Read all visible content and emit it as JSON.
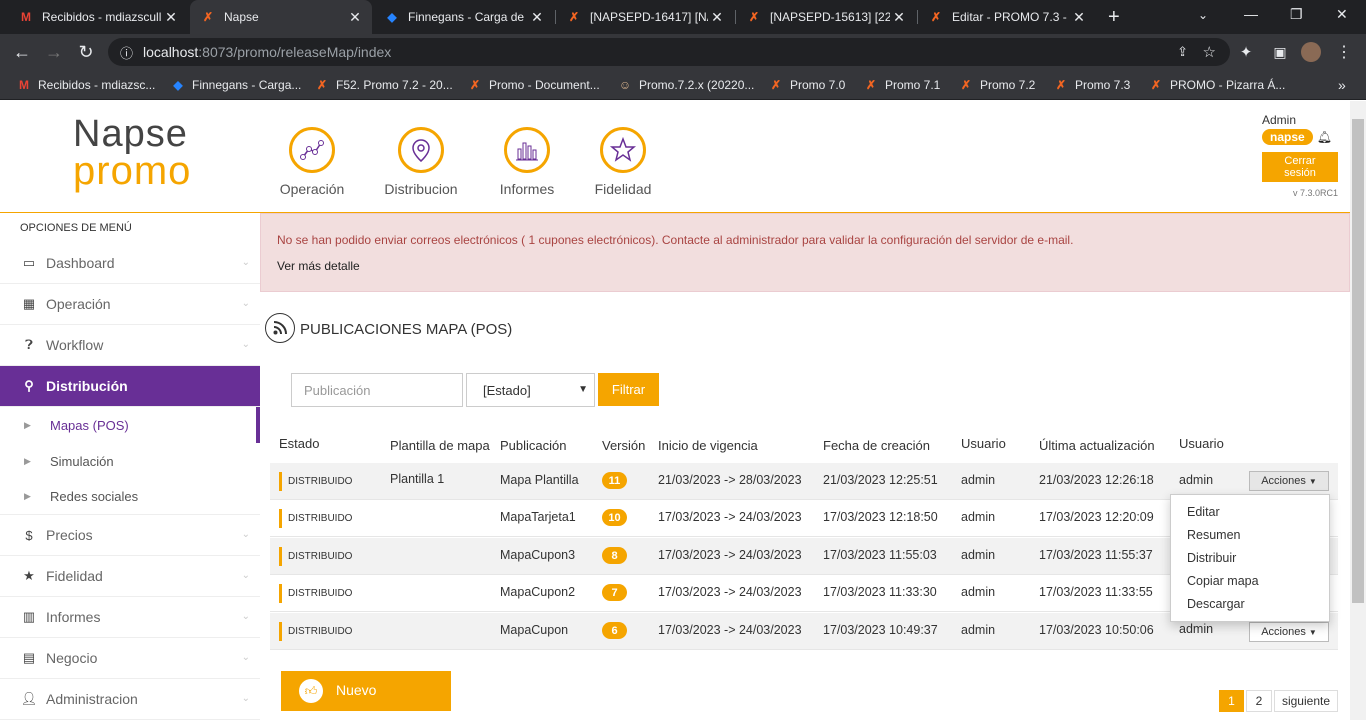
{
  "browser": {
    "tabs": [
      {
        "title": "Recibidos - mdiazscull",
        "icon": "gmail-icon"
      },
      {
        "title": "Napse",
        "icon": "napse-icon",
        "active": true
      },
      {
        "title": "Finnegans - Carga de",
        "icon": "jira-icon"
      },
      {
        "title": "[NAPSEPD-16417] [NA",
        "icon": "napse-icon"
      },
      {
        "title": "[NAPSEPD-15613] [22",
        "icon": "napse-icon"
      },
      {
        "title": "Editar - PROMO 7.3 - ",
        "icon": "napse-icon"
      }
    ],
    "url_host": "localhost",
    "url_path": ":8073/promo/releaseMap/index",
    "bookmarks": [
      {
        "label": "Recibidos - mdiazsc...",
        "icon": "gmail-icon"
      },
      {
        "label": "Finnegans - Carga...",
        "icon": "jira-icon"
      },
      {
        "label": "F52. Promo 7.2 - 20...",
        "icon": "napse-icon"
      },
      {
        "label": "Promo - Document...",
        "icon": "napse-icon"
      },
      {
        "label": "Promo.7.2.x (20220...",
        "icon": "jenkins-icon"
      },
      {
        "label": "Promo 7.0",
        "icon": "napse-icon"
      },
      {
        "label": "Promo 7.1",
        "icon": "napse-icon"
      },
      {
        "label": "Promo 7.2",
        "icon": "napse-icon"
      },
      {
        "label": "Promo 7.3",
        "icon": "napse-icon"
      },
      {
        "label": "PROMO - Pizarra Á...",
        "icon": "napse-icon"
      }
    ]
  },
  "header": {
    "logo_top": "Napse",
    "logo_bottom": "promo",
    "nav": [
      {
        "label": "Operación",
        "icon": "graph-icon"
      },
      {
        "label": "Distribucion",
        "icon": "map-pin-icon"
      },
      {
        "label": "Informes",
        "icon": "bar-chart-icon"
      },
      {
        "label": "Fidelidad",
        "icon": "star-icon"
      }
    ],
    "user": "Admin",
    "role": "napse",
    "logout": "Cerrar sesión",
    "version": "v 7.3.0RC1"
  },
  "sidebar": {
    "title": "OPCIONES DE MENÚ",
    "items": [
      {
        "label": "Dashboard",
        "icon": "laptop-icon"
      },
      {
        "label": "Operación",
        "icon": "grid-icon"
      },
      {
        "label": "Workflow",
        "icon": "question-circle-icon"
      },
      {
        "label": "Distribución",
        "icon": "map-pin-icon",
        "active": true
      },
      {
        "label": "Precios",
        "icon": "dollar-icon"
      },
      {
        "label": "Fidelidad",
        "icon": "star-icon"
      },
      {
        "label": "Informes",
        "icon": "bar-chart-icon"
      },
      {
        "label": "Negocio",
        "icon": "building-icon"
      },
      {
        "label": "Administracion",
        "icon": "user-icon"
      }
    ],
    "subitems": [
      {
        "label": "Mapas (POS)",
        "selected": true
      },
      {
        "label": "Simulación"
      },
      {
        "label": "Redes sociales"
      }
    ]
  },
  "alert": {
    "message": "No se han podido enviar correos electrónicos ( 1 cupones electrónicos). Contacte al administrador para validar la configuración del servidor de e-mail.",
    "link": "Ver más detalle"
  },
  "page": {
    "title": "PUBLICACIONES MAPA (POS)",
    "filters": {
      "publication_placeholder": "Publicación",
      "status_selected": "[Estado]",
      "filter_button": "Filtrar"
    }
  },
  "table": {
    "headers": [
      "Estado",
      "Plantilla de mapa",
      "Publicación",
      "Versión",
      "Inicio de vigencia",
      "Fecha de creación",
      "Usuario",
      "Última actualización",
      "Usuario"
    ],
    "rows": [
      {
        "status": "DISTRIBUIDO",
        "template": "Plantilla 1",
        "publication": "Mapa Plantilla",
        "version": "11",
        "validity": "21/03/2023 -> 28/03/2023",
        "created": "21/03/2023 12:25:51",
        "user": "admin",
        "updated": "21/03/2023 12:26:18",
        "updated_user": "admin"
      },
      {
        "status": "DISTRIBUIDO",
        "template": "",
        "publication": "MapaTarjeta1",
        "version": "10",
        "validity": "17/03/2023 -> 24/03/2023",
        "created": "17/03/2023 12:18:50",
        "user": "admin",
        "updated": "17/03/2023 12:20:09",
        "updated_user": ""
      },
      {
        "status": "DISTRIBUIDO",
        "template": "",
        "publication": "MapaCupon3",
        "version": "8",
        "validity": "17/03/2023 -> 24/03/2023",
        "created": "17/03/2023 11:55:03",
        "user": "admin",
        "updated": "17/03/2023 11:55:37",
        "updated_user": ""
      },
      {
        "status": "DISTRIBUIDO",
        "template": "",
        "publication": "MapaCupon2",
        "version": "7",
        "validity": "17/03/2023 -> 24/03/2023",
        "created": "17/03/2023 11:33:30",
        "user": "admin",
        "updated": "17/03/2023 11:33:55",
        "updated_user": ""
      },
      {
        "status": "DISTRIBUIDO",
        "template": "",
        "publication": "MapaCupon",
        "version": "6",
        "validity": "17/03/2023 -> 24/03/2023",
        "created": "17/03/2023 10:49:37",
        "user": "admin",
        "updated": "17/03/2023 10:50:06",
        "updated_user": "admin"
      }
    ],
    "actions_label": "Acciones",
    "actions_menu": [
      "Editar",
      "Resumen",
      "Distribuir",
      "Copiar mapa",
      "Descargar"
    ]
  },
  "footer": {
    "new_button": "Nuevo",
    "pages": [
      "1",
      "2"
    ],
    "next": "siguiente"
  },
  "colors": {
    "accent": "#f5a500",
    "purple": "#682f96",
    "alert_bg": "#f2dede"
  }
}
